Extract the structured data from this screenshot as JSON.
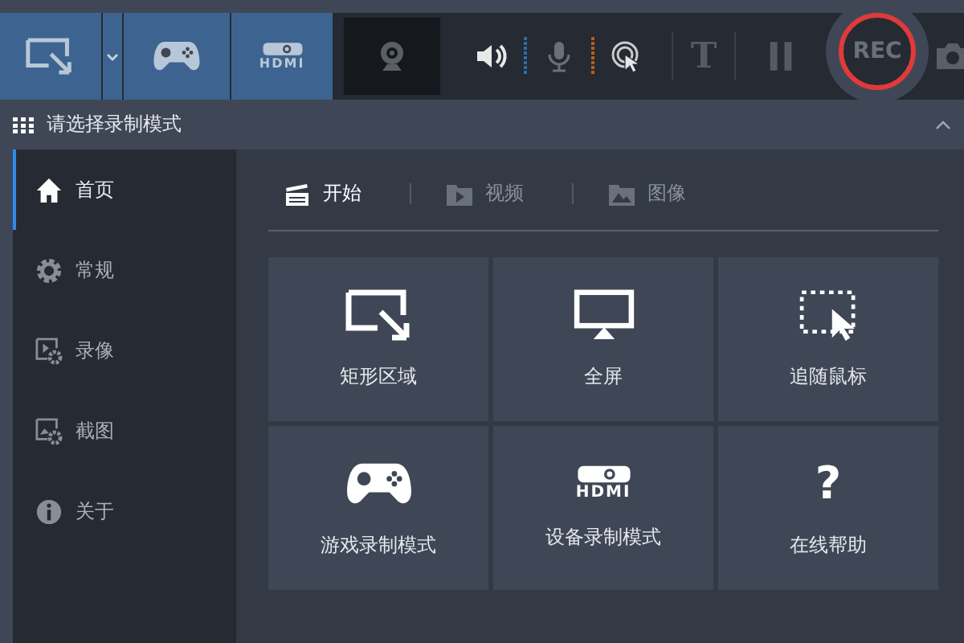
{
  "toolbar": {
    "mode_buttons": [
      {
        "kind": "rect"
      },
      {
        "kind": "game"
      },
      {
        "kind": "hdmi",
        "label": "HDMI"
      }
    ],
    "text_tool": "T",
    "rec_button": "REC"
  },
  "header": {
    "title": "请选择录制模式"
  },
  "sidebar": {
    "items": [
      {
        "label": "首页",
        "kind": "home",
        "selected": true
      },
      {
        "label": "常规",
        "kind": "gear",
        "selected": false
      },
      {
        "label": "录像",
        "kind": "video",
        "selected": false
      },
      {
        "label": "截图",
        "kind": "image",
        "selected": false
      },
      {
        "label": "关于",
        "kind": "info",
        "selected": false
      }
    ]
  },
  "tabs": [
    {
      "label": "开始",
      "kind": "clap",
      "selected": true
    },
    {
      "label": "视频",
      "kind": "folder-video",
      "selected": false
    },
    {
      "label": "图像",
      "kind": "folder-image",
      "selected": false
    }
  ],
  "tiles": [
    {
      "label": "矩形区域",
      "kind": "rect"
    },
    {
      "label": "全屏",
      "kind": "monitor"
    },
    {
      "label": "追随鼠标",
      "kind": "cursor"
    },
    {
      "label": "游戏录制模式",
      "kind": "game"
    },
    {
      "label": "设备录制模式",
      "kind": "hdmi",
      "badge": "HDMI"
    },
    {
      "label": "在线帮助",
      "kind": "help",
      "badge": "?"
    }
  ]
}
